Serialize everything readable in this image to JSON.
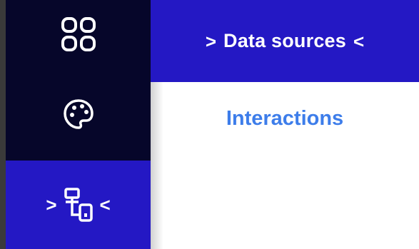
{
  "rail": {
    "items": [
      {
        "icon": "grid-icon"
      },
      {
        "icon": "palette-icon"
      },
      {
        "icon": "data-sources-icon",
        "active": true,
        "chevron_left": ">",
        "chevron_right": "<"
      }
    ]
  },
  "panel": {
    "header": {
      "chevron_left": ">",
      "title": "Data sources",
      "chevron_right": "<"
    },
    "links": [
      {
        "label": "Interactions"
      }
    ]
  },
  "colors": {
    "rail_bg": "#06062a",
    "accent": "#2418c4",
    "link": "#3d7dea"
  }
}
